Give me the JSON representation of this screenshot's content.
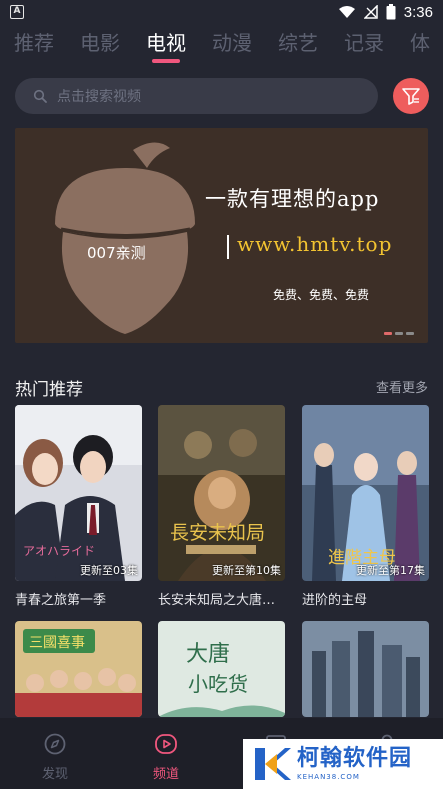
{
  "status_bar": {
    "time": "3:36",
    "app_icon_letter": "A"
  },
  "tabs": [
    {
      "label": "推荐",
      "active": false
    },
    {
      "label": "电影",
      "active": false
    },
    {
      "label": "电视",
      "active": true
    },
    {
      "label": "动漫",
      "active": false
    },
    {
      "label": "综艺",
      "active": false
    },
    {
      "label": "记录",
      "active": false
    },
    {
      "label": "体",
      "active": false
    }
  ],
  "search": {
    "placeholder": "点击搜索视频"
  },
  "banner": {
    "slogan": "一款有理想的app",
    "url": "www.hmtv.top",
    "tagline": "免费、免费、免费",
    "badge_text": "007亲测",
    "slide_count": 3,
    "active_slide": 1
  },
  "section": {
    "title": "热门推荐",
    "more_label": "查看更多"
  },
  "cards": [
    {
      "title": "青春之旅第一季",
      "badge": "更新至03集"
    },
    {
      "title": "长安未知局之大唐…",
      "badge": "更新至第10集"
    },
    {
      "title": "进阶的主母",
      "badge": "更新至第17集"
    },
    {
      "title": "",
      "badge": ""
    },
    {
      "title": "",
      "badge": ""
    },
    {
      "title": "",
      "badge": ""
    }
  ],
  "bottom_nav": [
    {
      "label": "发现",
      "icon": "compass-icon",
      "active": false
    },
    {
      "label": "频道",
      "icon": "play-icon",
      "active": true
    }
  ],
  "watermark": {
    "title": "柯翰软件园",
    "subtitle": "KEHAN38.COM"
  },
  "colors": {
    "accent": "#f0577e",
    "background": "#242631",
    "filter_button": "#ee5d5d"
  }
}
